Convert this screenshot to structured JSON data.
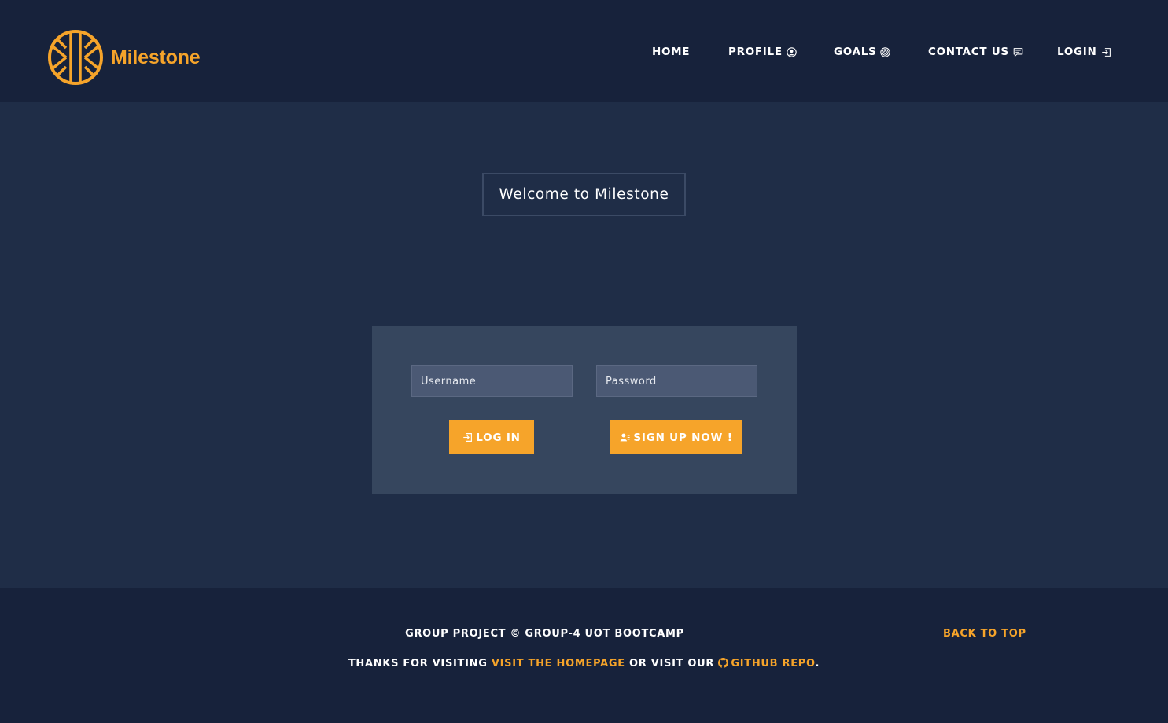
{
  "brand": {
    "name": "Milestone",
    "color": "#f6a42a",
    "logo_icon": "milestone-circle-logo"
  },
  "nav": {
    "items": [
      {
        "label": "HOME",
        "icon": null
      },
      {
        "label": "PROFILE",
        "icon": "user-circle-icon"
      },
      {
        "label": "GOALS",
        "icon": "target-icon"
      },
      {
        "label": "CONTACT US",
        "icon": "chat-icon"
      },
      {
        "label": "LOGIN",
        "icon": "sign-in-icon"
      }
    ]
  },
  "hero": {
    "title": "Welcome to Milestone"
  },
  "login_form": {
    "username_placeholder": "Username",
    "password_placeholder": "Password",
    "login_label": "LOG IN",
    "signup_label": "SIGN UP NOW !"
  },
  "footer": {
    "copyright": "GROUP PROJECT © GROUP-4 UOT BOOTCAMP",
    "back_to_top": "BACK TO TOP",
    "thanks_prefix": "THANKS FOR VISITING ",
    "homepage_link": "VISIT THE HOMEPAGE",
    "visit_text": " OR VISIT OUR ",
    "github_link": "GITHUB REPO",
    "period": "."
  },
  "colors": {
    "accent": "#f6a42a",
    "navbar_bg": "#17223b",
    "page_bg": "#1f2d47",
    "card_bg": "#36465e",
    "input_bg": "#4b5974"
  }
}
